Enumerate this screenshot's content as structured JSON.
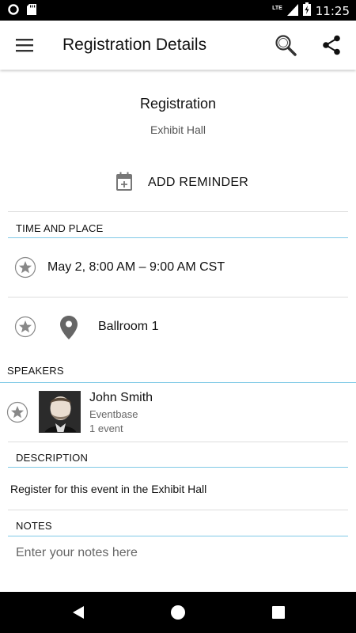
{
  "status_bar": {
    "time": "11:25",
    "network": "LTE"
  },
  "app_bar": {
    "title": "Registration Details",
    "icons": [
      "menu-icon",
      "search-icon",
      "share-icon"
    ]
  },
  "event": {
    "title": "Registration",
    "location_subtitle": "Exhibit Hall"
  },
  "reminder": {
    "label": "ADD REMINDER"
  },
  "time_and_place": {
    "header": "TIME AND PLACE",
    "time": "May 2, 8:00 AM – 9:00 AM CST",
    "place": "Ballroom 1"
  },
  "speakers": {
    "header": "SPEAKERS",
    "items": [
      {
        "name": "John Smith",
        "organization": "Eventbase",
        "event_count": "1 event"
      }
    ]
  },
  "description": {
    "header": "DESCRIPTION",
    "text": "Register for this event in the Exhibit Hall"
  },
  "notes": {
    "header": "NOTES",
    "placeholder": "Enter your notes here",
    "value": ""
  },
  "colors": {
    "accent_line": "#7fc9e6",
    "status_bar": "#000000",
    "icon_gray": "#757575"
  }
}
